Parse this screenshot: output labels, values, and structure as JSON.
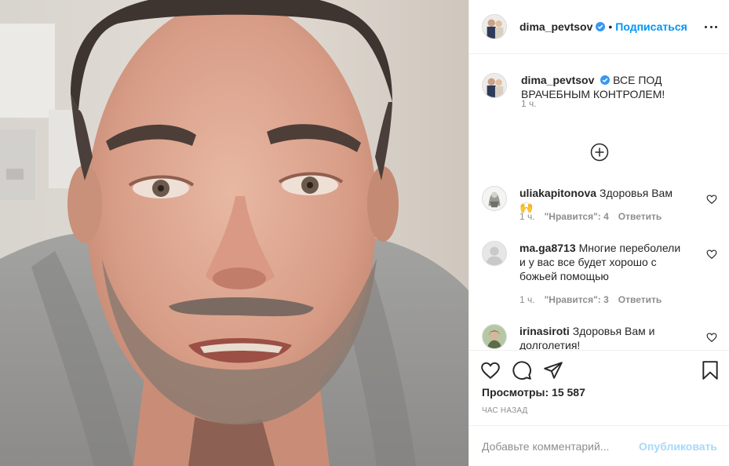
{
  "post": {
    "author": {
      "username": "dima_pevtsov",
      "verified": true,
      "follow_label": "Подписаться"
    },
    "caption": {
      "text": "ВСЕ ПОД ВРАЧЕБНЫМ КОНТРОЛЕМ!",
      "time": "1 ч."
    },
    "comments": [
      {
        "username": "uliakapitonova",
        "text": "Здоровья Вам🙌",
        "time": "1 ч.",
        "likes": "\"Нравится\": 4",
        "reply_label": "Ответить"
      },
      {
        "username": "ma.ga8713",
        "text": "Многие переболели и у вас все будет хорошо с божьей помощью",
        "time": "1 ч.",
        "likes": "\"Нравится\": 3",
        "reply_label": "Ответить"
      },
      {
        "username": "irinasiroti",
        "text": "Здоровья Вам и долголетия!",
        "time": "",
        "likes": "",
        "reply_label": ""
      }
    ],
    "views_label": "Просмотры:",
    "views_count": "15 587",
    "posted_ago": "ЧАС НАЗАД",
    "add_comment": {
      "placeholder": "Добавьте комментарий...",
      "publish_label": "Опубликовать"
    }
  },
  "colors": {
    "accent": "#0095f6",
    "text": "#262626",
    "muted": "#8e8e8e",
    "border": "#efefef"
  },
  "icons": [
    "verified-badge-icon",
    "more-options-icon",
    "load-more-comments-icon",
    "heart-icon",
    "comment-icon",
    "share-icon",
    "save-icon"
  ]
}
